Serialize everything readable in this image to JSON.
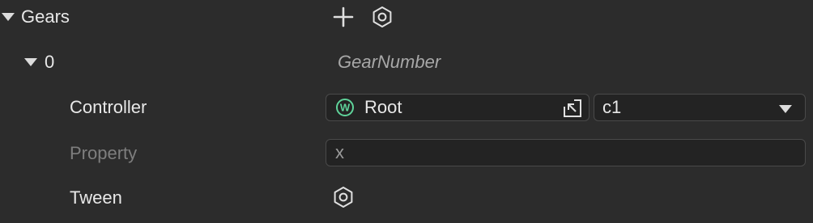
{
  "section": {
    "title": "Gears",
    "add_icon": "plus-icon",
    "settings_icon": "hexagon-gear-icon"
  },
  "gear": {
    "index": "0",
    "name": "GearNumber",
    "controller": {
      "label": "Controller",
      "object_icon": "w-component-icon",
      "object_icon_letter": "W",
      "object_value": "Root",
      "locate_icon": "locate-arrow-icon",
      "select_value": "c1",
      "dropdown_icon": "chevron-down-icon"
    },
    "property": {
      "label": "Property",
      "value": "x"
    },
    "tween": {
      "label": "Tween",
      "icon": "hexagon-gear-icon"
    }
  },
  "colors": {
    "background": "#2c2c2c",
    "field_bg": "#232323",
    "field_border": "#4a4a4a",
    "text": "#e8e8e8",
    "dim_text": "#7e7e7e",
    "accent_green": "#5fd39a"
  }
}
